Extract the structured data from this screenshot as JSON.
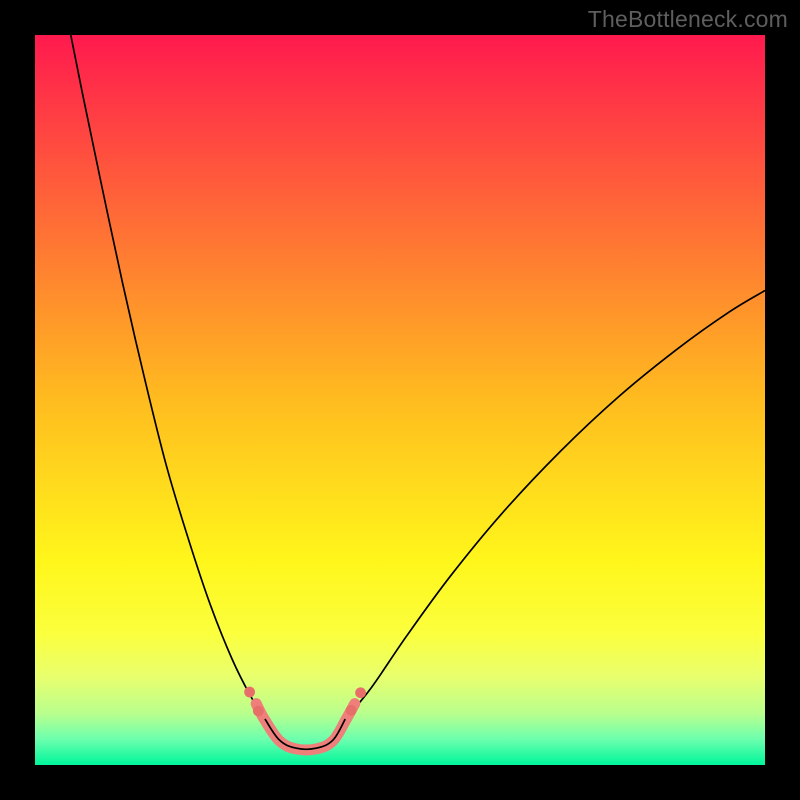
{
  "watermark": "TheBottleneck.com",
  "chart_data": {
    "type": "line",
    "title": "",
    "xlabel": "",
    "ylabel": "",
    "xlim": [
      0,
      100
    ],
    "ylim": [
      0,
      100
    ],
    "grid": false,
    "legend": false,
    "background_gradient": {
      "stops": [
        {
          "pos": 0.0,
          "color": "#ff1a4e"
        },
        {
          "pos": 0.5,
          "color": "#ffbc1f"
        },
        {
          "pos": 0.72,
          "color": "#fff61b"
        },
        {
          "pos": 0.82,
          "color": "#fbff3d"
        },
        {
          "pos": 0.88,
          "color": "#e8ff6e"
        },
        {
          "pos": 0.93,
          "color": "#b8ff8e"
        },
        {
          "pos": 0.965,
          "color": "#6bffae"
        },
        {
          "pos": 1.0,
          "color": "#00f59a"
        }
      ]
    },
    "series": [
      {
        "name": "left-arm",
        "stroke": "#000000",
        "stroke_width": 1.7,
        "points": [
          {
            "x": 4.9,
            "y": 100.0
          },
          {
            "x": 6.5,
            "y": 92.0
          },
          {
            "x": 9.0,
            "y": 80.0
          },
          {
            "x": 12.0,
            "y": 66.0
          },
          {
            "x": 15.0,
            "y": 53.0
          },
          {
            "x": 18.0,
            "y": 41.0
          },
          {
            "x": 21.0,
            "y": 31.0
          },
          {
            "x": 24.0,
            "y": 22.0
          },
          {
            "x": 27.0,
            "y": 14.5
          },
          {
            "x": 29.5,
            "y": 9.5
          },
          {
            "x": 31.5,
            "y": 6.3
          }
        ]
      },
      {
        "name": "right-arm",
        "stroke": "#000000",
        "stroke_width": 1.7,
        "points": [
          {
            "x": 42.5,
            "y": 6.3
          },
          {
            "x": 46.0,
            "y": 10.5
          },
          {
            "x": 51.0,
            "y": 17.8
          },
          {
            "x": 57.0,
            "y": 26.0
          },
          {
            "x": 64.0,
            "y": 34.5
          },
          {
            "x": 72.0,
            "y": 43.0
          },
          {
            "x": 80.0,
            "y": 50.5
          },
          {
            "x": 88.0,
            "y": 57.0
          },
          {
            "x": 95.0,
            "y": 62.0
          },
          {
            "x": 100.0,
            "y": 65.0
          }
        ]
      },
      {
        "name": "marker-band",
        "stroke": "#ee7f7b",
        "stroke_width": 11,
        "linecap": "round",
        "points": [
          {
            "x": 30.3,
            "y": 8.4
          },
          {
            "x": 31.4,
            "y": 6.3
          },
          {
            "x": 33.5,
            "y": 3.3
          },
          {
            "x": 35.8,
            "y": 2.2
          },
          {
            "x": 38.5,
            "y": 2.2
          },
          {
            "x": 40.8,
            "y": 3.3
          },
          {
            "x": 42.7,
            "y": 6.4
          },
          {
            "x": 43.8,
            "y": 8.4
          }
        ]
      },
      {
        "name": "valley-overlay",
        "stroke": "#000000",
        "stroke_width": 1.7,
        "points": [
          {
            "x": 31.5,
            "y": 6.3
          },
          {
            "x": 33.5,
            "y": 3.4
          },
          {
            "x": 35.8,
            "y": 2.3
          },
          {
            "x": 38.5,
            "y": 2.3
          },
          {
            "x": 40.8,
            "y": 3.4
          },
          {
            "x": 42.5,
            "y": 6.3
          }
        ]
      }
    ],
    "marker_dots": {
      "color": "#e86f69",
      "radius": 5.4,
      "points": [
        {
          "x": 29.4,
          "y": 10.0
        },
        {
          "x": 30.6,
          "y": 7.4
        },
        {
          "x": 43.3,
          "y": 7.5
        },
        {
          "x": 44.6,
          "y": 9.9
        }
      ]
    }
  }
}
